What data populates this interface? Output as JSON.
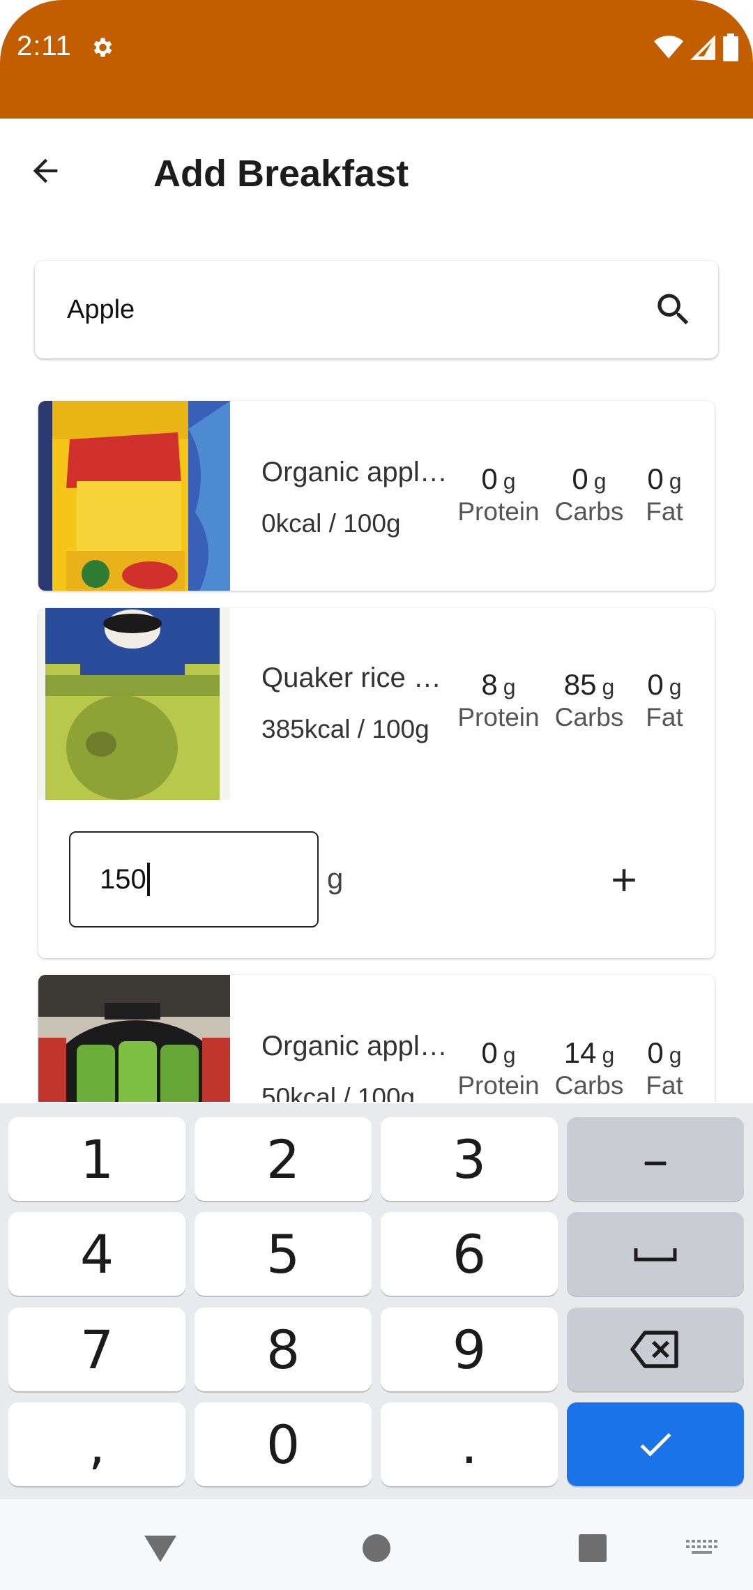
{
  "status_bar": {
    "time": "2:11",
    "background": "#C25E00",
    "icons": [
      "gear-icon",
      "wifi-icon",
      "signal-icon",
      "battery-icon"
    ]
  },
  "app_bar": {
    "title": "Add Breakfast",
    "back_icon": "arrow-back-icon"
  },
  "search": {
    "value": "Apple",
    "placeholder": "",
    "icon": "search-icon"
  },
  "products": [
    {
      "name": "Organic appl…",
      "kcal": "0kcal / 100g",
      "thumb_icon": "apple-cider-vinegar-photo",
      "macros": [
        {
          "value": "0",
          "unit": "g",
          "label": "Protein"
        },
        {
          "value": "0",
          "unit": "g",
          "label": "Carbs"
        },
        {
          "value": "0",
          "unit": "g",
          "label": "Fat"
        }
      ]
    },
    {
      "name": "Quaker rice …",
      "kcal": "385kcal / 100g",
      "thumb_icon": "quaker-package-photo",
      "macros": [
        {
          "value": "8",
          "unit": "g",
          "label": "Protein"
        },
        {
          "value": "85",
          "unit": "g",
          "label": "Carbs"
        },
        {
          "value": "0",
          "unit": "g",
          "label": "Fat"
        }
      ],
      "quantity": {
        "value": "150",
        "unit": "g",
        "add_icon": "plus-icon"
      }
    },
    {
      "name": "Organic appl…",
      "kcal": "50kcal / 100g",
      "thumb_icon": "applesauce-pouches-photo",
      "macros": [
        {
          "value": "0",
          "unit": "g",
          "label": "Protein"
        },
        {
          "value": "14",
          "unit": "g",
          "label": "Carbs"
        },
        {
          "value": "0",
          "unit": "g",
          "label": "Fat"
        }
      ]
    }
  ],
  "keyboard": {
    "keys": [
      "1",
      "2",
      "3",
      "4",
      "5",
      "6",
      "7",
      "8",
      "9",
      ",",
      "0",
      "."
    ],
    "function_keys": [
      "minus-key",
      "space-key",
      "backspace-key",
      "done-key"
    ],
    "minus_label": "–",
    "accent": "#1A73E8"
  },
  "nav_bar": {
    "buttons": [
      "back-triangle-icon",
      "home-circle-icon",
      "recents-square-icon",
      "keyboard-switch-icon"
    ]
  }
}
